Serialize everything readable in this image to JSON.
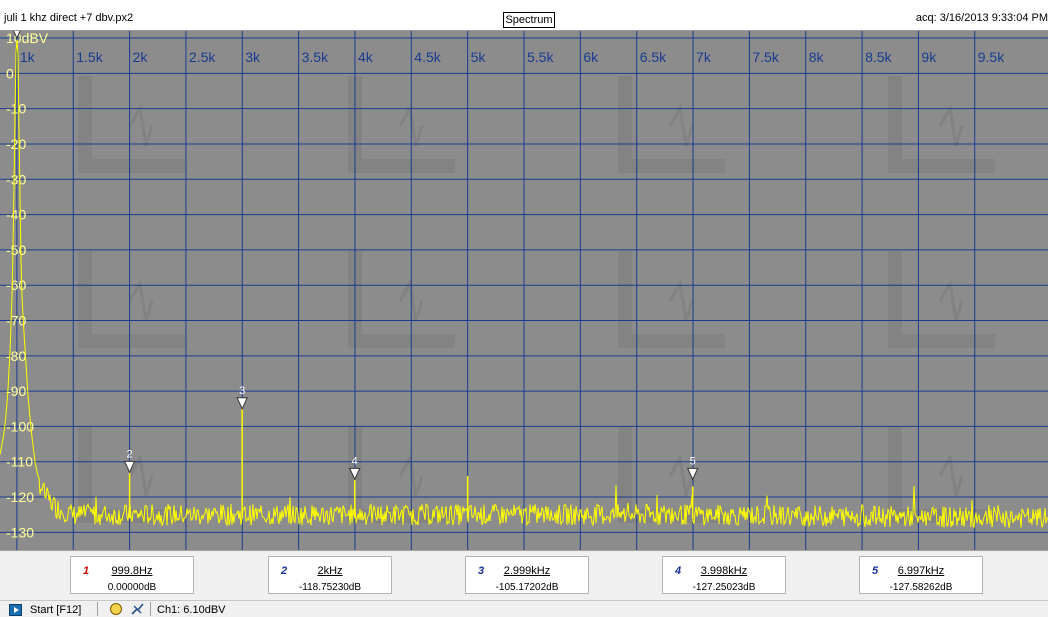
{
  "window": {
    "file_name": "juli 1 khz direct +7 dbv.px2",
    "view_tab": "Spectrum",
    "acquired": "acq: 3/16/2013 9:33:04 PM"
  },
  "colors": {
    "trace": "#ffff00",
    "grid": "#1a3b8f",
    "plot_bg": "#8c8c8c",
    "marker_fill": "#ffffff",
    "axis_label_y": "#ffff99",
    "axis_label_x": "#1a3b8f"
  },
  "chart_data": {
    "type": "line",
    "x_tick_labels": [
      "1k",
      "1.5k",
      "2k",
      "2.5k",
      "3k",
      "3.5k",
      "4k",
      "4.5k",
      "5k",
      "5.5k",
      "6k",
      "6.5k",
      "7k",
      "7.5k",
      "8k",
      "8.5k",
      "9k",
      "9.5k"
    ],
    "y_tick_labels": [
      "10dBV",
      "0",
      "-10",
      "-20",
      "-30",
      "-40",
      "-50",
      "-60",
      "-70",
      "-80",
      "-90",
      "-100",
      "-110",
      "-120",
      "-130"
    ],
    "xlim": [
      850,
      10150
    ],
    "ylim": [
      -135,
      12
    ],
    "grid": true,
    "series": [
      {
        "noise_floor_db": -126,
        "points": [
          [
            850,
            -108
          ],
          [
            880,
            -103
          ],
          [
            900,
            -98
          ],
          [
            920,
            -90
          ],
          [
            940,
            -78
          ],
          [
            960,
            -60
          ],
          [
            980,
            -20
          ],
          [
            990,
            5
          ],
          [
            999.8,
            10
          ],
          [
            1010,
            5
          ],
          [
            1020,
            -20
          ],
          [
            1040,
            -60
          ],
          [
            1060,
            -72
          ],
          [
            1080,
            -82
          ],
          [
            1100,
            -92
          ],
          [
            1130,
            -102
          ],
          [
            1160,
            -110
          ],
          [
            1200,
            -116
          ],
          [
            1260,
            -120
          ],
          [
            1350,
            -123
          ],
          [
            1500,
            -125
          ],
          [
            1999,
            -125
          ],
          [
            2000,
            -113
          ],
          [
            2001,
            -125
          ],
          [
            2998,
            -125
          ],
          [
            2999,
            -95
          ],
          [
            3000,
            -125
          ],
          [
            3997,
            -125
          ],
          [
            3998,
            -115
          ],
          [
            3999,
            -125
          ],
          [
            4999,
            -125
          ],
          [
            5000,
            -114
          ],
          [
            5001,
            -125
          ],
          [
            6996,
            -125
          ],
          [
            6997,
            -117
          ],
          [
            6998,
            -125
          ],
          [
            10150,
            -126
          ]
        ]
      }
    ],
    "markers": [
      {
        "id": "1",
        "freq": "999.8Hz",
        "level": "0.00000dB",
        "x": 999.8,
        "y": 10
      },
      {
        "id": "2",
        "freq": "2kHz",
        "level": "-118.75230dB",
        "x": 2000,
        "y": -113
      },
      {
        "id": "3",
        "freq": "2.999kHz",
        "level": "-105.17202dB",
        "x": 2999,
        "y": -95
      },
      {
        "id": "4",
        "freq": "3.998kHz",
        "level": "-127.25023dB",
        "x": 3998,
        "y": -115
      },
      {
        "id": "5",
        "freq": "6.997kHz",
        "level": "-127.58262dB",
        "x": 6997,
        "y": -115
      }
    ]
  },
  "status": {
    "start_label": "Start [F12]",
    "channel_readout": "Ch1: 6.10dBV"
  }
}
